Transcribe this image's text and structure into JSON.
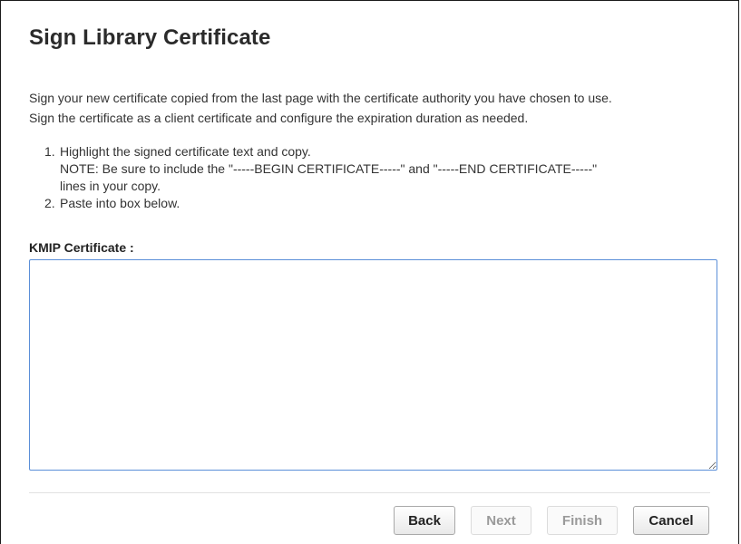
{
  "dialog": {
    "title": "Sign Library Certificate",
    "intro": [
      "Sign your new certificate copied from the last page with the certificate authority you have chosen to use.",
      "Sign the certificate as a client certificate and configure the expiration duration as needed."
    ],
    "steps": [
      {
        "number": "1.",
        "lines": [
          "Highlight the signed certificate text and copy.",
          "NOTE: Be sure to include the \"-----BEGIN CERTIFICATE-----\" and \"-----END CERTIFICATE-----\"",
          "lines in your copy."
        ]
      },
      {
        "number": "2.",
        "lines": [
          "Paste into box below."
        ]
      }
    ],
    "field_label": "KMIP Certificate :",
    "certificate_value": ""
  },
  "buttons": {
    "back": {
      "label": "Back",
      "enabled": true
    },
    "next": {
      "label": "Next",
      "enabled": false
    },
    "finish": {
      "label": "Finish",
      "enabled": false
    },
    "cancel": {
      "label": "Cancel",
      "enabled": true
    }
  },
  "colors": {
    "textarea_focus_border": "#5b8fd8",
    "title_text": "#2b2b2b",
    "disabled_text": "#9a9a9a"
  }
}
